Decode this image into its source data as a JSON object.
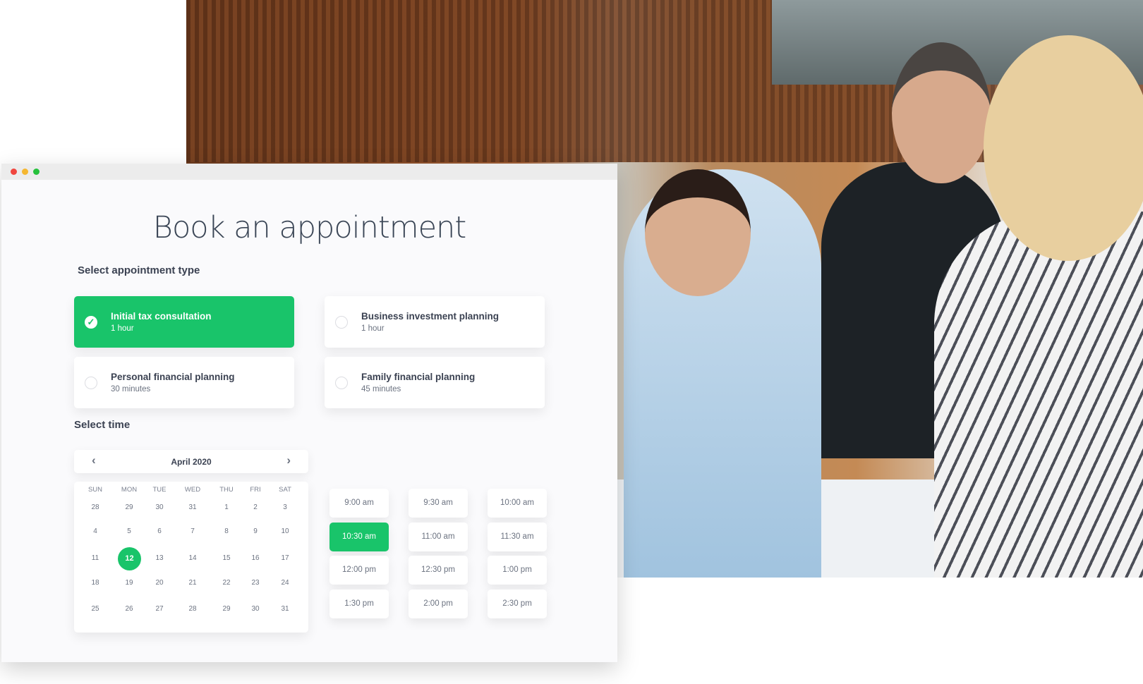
{
  "colors": {
    "accent": "#19c46a",
    "close": "#f0463f",
    "minimize": "#f5b731",
    "maximize": "#26c13c"
  },
  "title": "Book an appointment",
  "appointment_section_label": "Select appointment type",
  "appointment_types": [
    {
      "name": "Initial tax consultation",
      "duration": "1 hour",
      "selected": true
    },
    {
      "name": "Business investment planning",
      "duration": "1 hour",
      "selected": false
    },
    {
      "name": "Personal financial planning",
      "duration": "30 minutes",
      "selected": false
    },
    {
      "name": "Family financial planning",
      "duration": "45 minutes",
      "selected": false
    }
  ],
  "time_section_label": "Select time",
  "calendar": {
    "month": "April 2020",
    "prev_icon": "chevron-left-icon",
    "next_icon": "chevron-right-icon",
    "weekdays": [
      "SUN",
      "MON",
      "TUE",
      "WED",
      "THU",
      "FRI",
      "SAT"
    ],
    "weeks": [
      [
        "28",
        "29",
        "30",
        "31",
        "1",
        "2",
        "3"
      ],
      [
        "4",
        "5",
        "6",
        "7",
        "8",
        "9",
        "10"
      ],
      [
        "11",
        "12",
        "13",
        "14",
        "15",
        "16",
        "17"
      ],
      [
        "18",
        "19",
        "20",
        "21",
        "22",
        "23",
        "24"
      ],
      [
        "25",
        "26",
        "27",
        "28",
        "29",
        "30",
        "31"
      ]
    ],
    "selected_day": "12"
  },
  "time_slots": [
    "9:00 am",
    "9:30 am",
    "10:00 am",
    "10:30 am",
    "11:00 am",
    "11:30 am",
    "12:00 pm",
    "12:30 pm",
    "1:00 pm",
    "1:30 pm",
    "2:00 pm",
    "2:30 pm"
  ],
  "selected_time": "10:30 am"
}
